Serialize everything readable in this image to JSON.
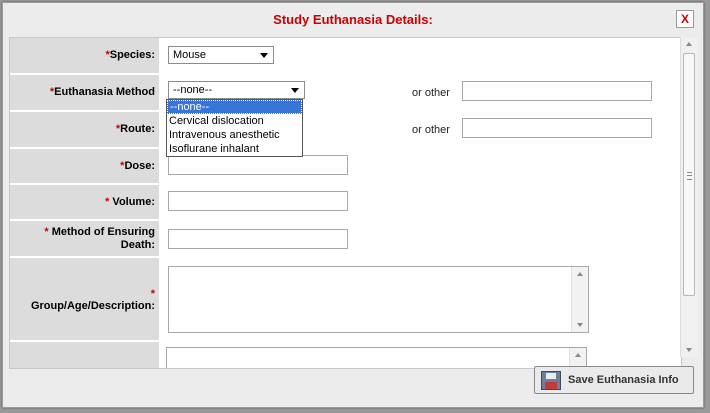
{
  "dialog": {
    "title": "Study Euthanasia Details:",
    "close_label": "X"
  },
  "form": {
    "species": {
      "label": "Species:",
      "required": "*",
      "value": "Mouse"
    },
    "method": {
      "label": "Euthanasia Method",
      "required": "*",
      "value": "--none--",
      "or_other": "or other",
      "other_value": ""
    },
    "route": {
      "label": "Route:",
      "required": "*",
      "or_other": "or other",
      "other_value": ""
    },
    "dose": {
      "label": "Dose:",
      "required": "*",
      "value": ""
    },
    "volume": {
      "label": "Volume:",
      "required": "* ",
      "value": ""
    },
    "ensuring": {
      "label_line1": "Method of Ensuring",
      "label_line2": "Death:",
      "required": "* ",
      "value": ""
    },
    "group": {
      "label": "Group/Age/Description:",
      "required": "*",
      "value": ""
    }
  },
  "dropdown": {
    "options": [
      "--none--",
      "Cervical dislocation",
      "Intravenous anesthetic",
      "Isoflurane inhalant"
    ],
    "selected_index": 0
  },
  "footer": {
    "save_label": "Save Euthanasia Info"
  },
  "colors": {
    "required": "#cc0000",
    "title": "#cc0000",
    "selection": "#3875d7",
    "label_bg": "#dcdcdc"
  },
  "icons": {
    "close": "close-icon",
    "save": "floppy-disk-icon",
    "dropdown": "chevron-down-icon"
  }
}
